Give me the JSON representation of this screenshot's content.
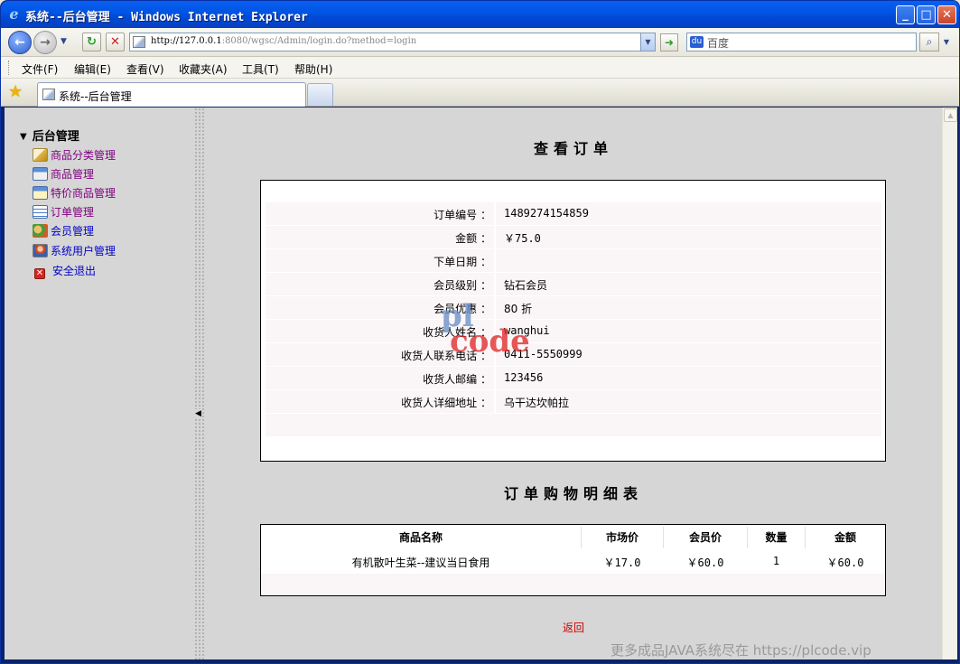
{
  "window": {
    "title": "系统--后台管理 - Windows Internet Explorer",
    "minimize": "_",
    "maximize": "□",
    "close": "✕"
  },
  "browser": {
    "address_host": "http://127.0.0.1",
    "address_rest": ":8080/wgsc/Admin/login.do?method=login",
    "search_placeholder": "百度",
    "menu": [
      "文件(F)",
      "编辑(E)",
      "查看(V)",
      "收藏夹(A)",
      "工具(T)",
      "帮助(H)"
    ],
    "tab_title": "系统--后台管理"
  },
  "sidebar": {
    "root": "后台管理",
    "items": [
      {
        "label": "商品分类管理",
        "icon": "category-icon"
      },
      {
        "label": "商品管理",
        "icon": "goods-icon"
      },
      {
        "label": "特价商品管理",
        "icon": "special-goods-icon"
      },
      {
        "label": "订单管理",
        "icon": "order-icon"
      },
      {
        "label": "会员管理",
        "icon": "member-icon"
      },
      {
        "label": "系统用户管理",
        "icon": "user-icon"
      },
      {
        "label": "安全退出",
        "icon": "exit-icon"
      }
    ]
  },
  "order": {
    "heading": "查看订单",
    "fields": [
      {
        "label": "订单编号 ：",
        "value": "1489274154859"
      },
      {
        "label": "金额 ：",
        "value": "￥75.0"
      },
      {
        "label": "下单日期 ：",
        "value": ""
      },
      {
        "label": "会员级别 ：",
        "value": "钻石会员"
      },
      {
        "label": "会员优惠 ：",
        "value": "80 折"
      },
      {
        "label": "收货人姓名 ：",
        "value": "wanghui"
      },
      {
        "label": "收货人联系电话 ：",
        "value": "0411-5550999"
      },
      {
        "label": "收货人邮编 ：",
        "value": "123456"
      },
      {
        "label": "收货人详细地址 ：",
        "value": "乌干达坎帕拉"
      }
    ]
  },
  "details": {
    "heading": "订单购物明细表",
    "columns": [
      "商品名称",
      "市场价",
      "会员价",
      "数量",
      "金额"
    ],
    "rows": [
      [
        "有机散叶生菜--建议当日食用",
        "￥17.0",
        "￥60.0",
        "1",
        "￥60.0"
      ]
    ]
  },
  "back_link": "返回",
  "watermark": {
    "line1": "pl",
    "line2": "code"
  },
  "footer_watermark": "更多成品JAVA系统尽在 https://plcode.vip"
}
